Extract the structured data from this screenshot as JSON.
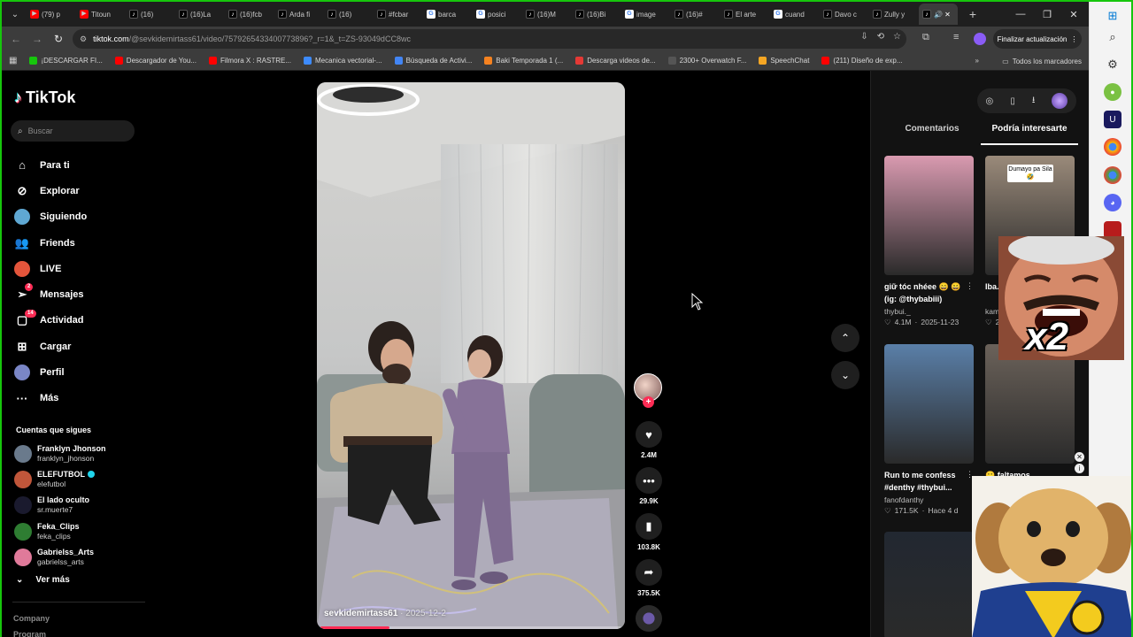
{
  "browser": {
    "tabs": [
      {
        "label": "(79) p",
        "favicon": "youtube"
      },
      {
        "label": "Titoun",
        "favicon": "youtube"
      },
      {
        "label": "(16)",
        "favicon": "tiktok"
      },
      {
        "label": "(16)La",
        "favicon": "tiktok"
      },
      {
        "label": "(16)fcb",
        "favicon": "tiktok"
      },
      {
        "label": "Arda fi",
        "favicon": "tiktok"
      },
      {
        "label": "(16)",
        "favicon": "tiktok"
      },
      {
        "label": "#fcbar",
        "favicon": "tiktok"
      },
      {
        "label": "barca",
        "favicon": "google"
      },
      {
        "label": "posici",
        "favicon": "google"
      },
      {
        "label": "(16)M",
        "favicon": "tiktok"
      },
      {
        "label": "(16)Bi",
        "favicon": "tiktok"
      },
      {
        "label": "image",
        "favicon": "google"
      },
      {
        "label": "(16)#",
        "favicon": "tiktok"
      },
      {
        "label": "El arte",
        "favicon": "tiktok"
      },
      {
        "label": "cuand",
        "favicon": "google"
      },
      {
        "label": "Davo c",
        "favicon": "tiktok"
      },
      {
        "label": "Zully y",
        "favicon": "tiktok"
      }
    ],
    "active_tab_icons": "🔊 ✕",
    "url_host": "tiktok.com",
    "url_path": "/@sevkidemirtass61/video/7579265433400773896?_r=1&_t=ZS-93049dCC8wc",
    "update_button": "Finalizar actualización",
    "bookmarks": [
      {
        "label": "¡DESCARGAR FI...",
        "color": "#16c60c"
      },
      {
        "label": "Descargador de You...",
        "color": "#ff0000"
      },
      {
        "label": "Filmora X : RASTRE...",
        "color": "#ff0000"
      },
      {
        "label": "Mecanica vectorial-...",
        "color": "#3d8bfd"
      },
      {
        "label": "Búsqueda de Activi...",
        "color": "#4285f4"
      },
      {
        "label": "Baki Temporada 1 (...",
        "color": "#f58220"
      },
      {
        "label": "Descarga videos de...",
        "color": "#e53935"
      },
      {
        "label": "2300+ Overwatch F...",
        "color": "#555555"
      },
      {
        "label": "SpeechChat",
        "color": "#f5a623"
      },
      {
        "label": "(211) Diseño de exp...",
        "color": "#ff0000"
      }
    ],
    "bookmarks_all": "Todos los marcadores"
  },
  "tiktok": {
    "logo": "TikTok",
    "search_placeholder": "Buscar",
    "nav": [
      {
        "label": "Para ti",
        "icon": "home-icon",
        "glyph": "⌂"
      },
      {
        "label": "Explorar",
        "icon": "compass-icon",
        "glyph": "⊘"
      },
      {
        "label": "Siguiendo",
        "icon": "following-icon",
        "glyph": "◉"
      },
      {
        "label": "Friends",
        "icon": "friends-icon",
        "glyph": "👥"
      },
      {
        "label": "LIVE",
        "icon": "live-icon",
        "glyph": "◉"
      },
      {
        "label": "Mensajes",
        "icon": "messages-icon",
        "glyph": "➢",
        "badge": "2"
      },
      {
        "label": "Actividad",
        "icon": "activity-icon",
        "glyph": "▢",
        "badge": "14"
      },
      {
        "label": "Cargar",
        "icon": "upload-icon",
        "glyph": "⊞"
      },
      {
        "label": "Perfil",
        "icon": "profile-icon",
        "glyph": "◉"
      },
      {
        "label": "Más",
        "icon": "more-icon",
        "glyph": "···"
      }
    ],
    "following_title": "Cuentas que sigues",
    "following": [
      {
        "name": "Franklyn Jhonson",
        "user": "franklyn_jhonson",
        "color": "#6a7a8c",
        "verified": false
      },
      {
        "name": "ELEFUTBOL",
        "user": "elefutbol",
        "color": "#c0563a",
        "verified": true
      },
      {
        "name": "El lado oculto",
        "user": "sr.muerte7",
        "color": "#1a1a2e",
        "verified": false
      },
      {
        "name": "Feka_Clips",
        "user": "feka_clips",
        "color": "#2e7d32",
        "verified": false
      },
      {
        "name": "Gabrielss_Arts",
        "user": "gabrielss_arts",
        "color": "#e07a9a",
        "verified": false
      }
    ],
    "see_more": "Ver más",
    "footer_links": [
      "Company",
      "Program"
    ]
  },
  "video": {
    "author": "sevkidemirtass61",
    "date": "2025-12-2",
    "progress": 0.23,
    "likes": "2.4M",
    "comments": "29.9K",
    "saves": "103.8K",
    "shares": "375.5K"
  },
  "right_panel": {
    "tabs": [
      "Comentarios",
      "Podría interesarte"
    ],
    "active_tab": 1,
    "cards": [
      {
        "title": "giữ tóc nhéee 😄 😄 (ig: @thybabiii)",
        "author": "thybui._",
        "views": "4.1M",
        "date": "2025-11-23",
        "bg": "#d99ab0"
      },
      {
        "title": "Iba... gal...",
        "author": "kam...",
        "views": "2...",
        "date": "",
        "bg": "#9a8a7a",
        "caption": "Dumayo pa Sila 🤣"
      },
      {
        "title": "Run to me confess #denthy #thybui...",
        "author": "fanofdanthy",
        "views": "171.5K",
        "date": "Hace 4 d",
        "bg": "#5a7fa8"
      },
      {
        "title": "🙂 faltamos...",
        "author": "",
        "views": "",
        "date": "",
        "bg": "#6b625a"
      },
      {
        "title": "",
        "author": "",
        "views": "",
        "date": "",
        "bg": "#222831"
      }
    ]
  },
  "overlays": {
    "meme_text": "x2"
  },
  "colors": {
    "accent": "#fe2c55",
    "frame": "#16c60c"
  }
}
